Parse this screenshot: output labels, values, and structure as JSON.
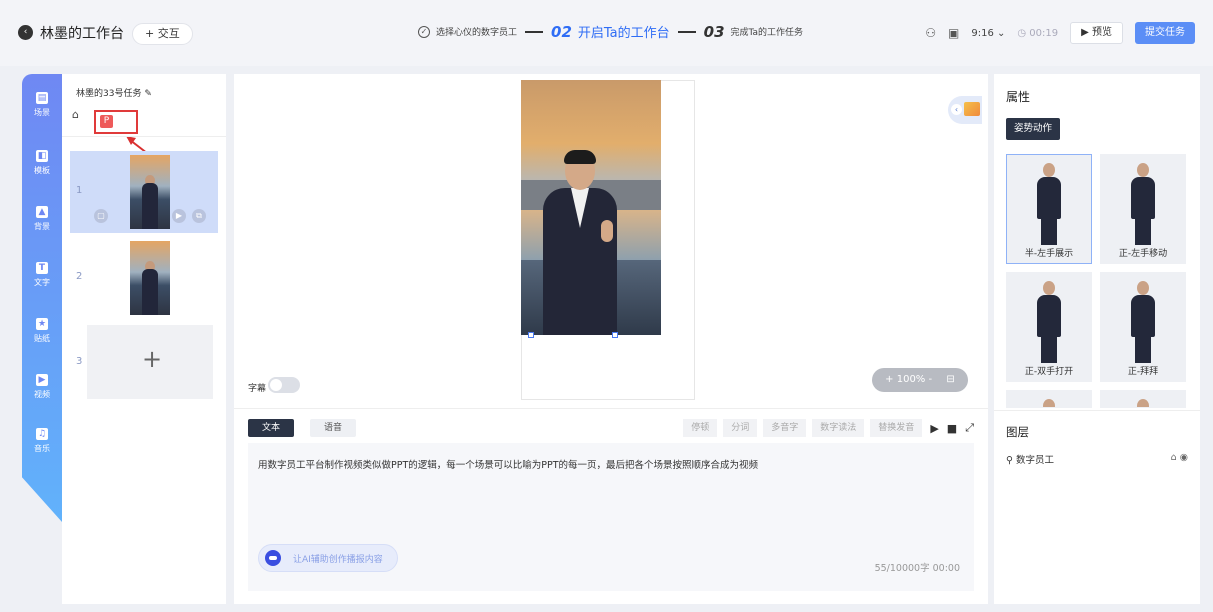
{
  "header": {
    "back_icon": "arrow-left-icon",
    "title": "林墨的工作台",
    "interact_label": "+ 交互",
    "steps": {
      "step1_label": "选择心仪的数字员工",
      "step2_num": "02",
      "step2_label": "开启Ta的工作台",
      "step3_num": "03",
      "step3_label": "完成Ta的工作任务"
    },
    "ratio": "9:16",
    "timer": "00:19",
    "preview_label": "预览",
    "submit_label": "提交任务",
    "accent": "#2f6df5"
  },
  "rail": {
    "items": [
      {
        "icon": "scene-icon",
        "label": "场景"
      },
      {
        "icon": "template-icon",
        "label": "模板"
      },
      {
        "icon": "background-icon",
        "label": "背景"
      },
      {
        "icon": "text-icon",
        "label": "文字"
      },
      {
        "icon": "sticker-icon",
        "label": "贴纸"
      },
      {
        "icon": "video-icon",
        "label": "视频"
      },
      {
        "icon": "music-icon",
        "label": "音乐"
      }
    ]
  },
  "scenes": {
    "task_name": "林墨的33号任务",
    "p_badge": "P",
    "items": [
      {
        "num": "1"
      },
      {
        "num": "2"
      },
      {
        "num": "3"
      }
    ]
  },
  "canvas": {
    "subtitle_label": "字幕",
    "zoom": "+ 100% -"
  },
  "script": {
    "tab_text": "文本",
    "tab_voice": "语音",
    "tools": [
      "停顿",
      "分词",
      "多音字",
      "数字读法",
      "替换发音"
    ],
    "content": "用数字员工平台制作视频类似做PPT的逻辑，每一个场景可以比喻为PPT的每一页，最后把各个场景按照顺序合成为视频",
    "ai_label": "让AI辅助创作播报内容",
    "counter": "55/10000字   00:00"
  },
  "props": {
    "title": "属性",
    "pose_tab": "姿势动作",
    "poses": [
      {
        "name": "半-左手展示"
      },
      {
        "name": "正-左手移动"
      },
      {
        "name": "正-双手打开"
      },
      {
        "name": "正-拜拜"
      }
    ],
    "layers_title": "图层",
    "layer_name": "数字员工"
  }
}
